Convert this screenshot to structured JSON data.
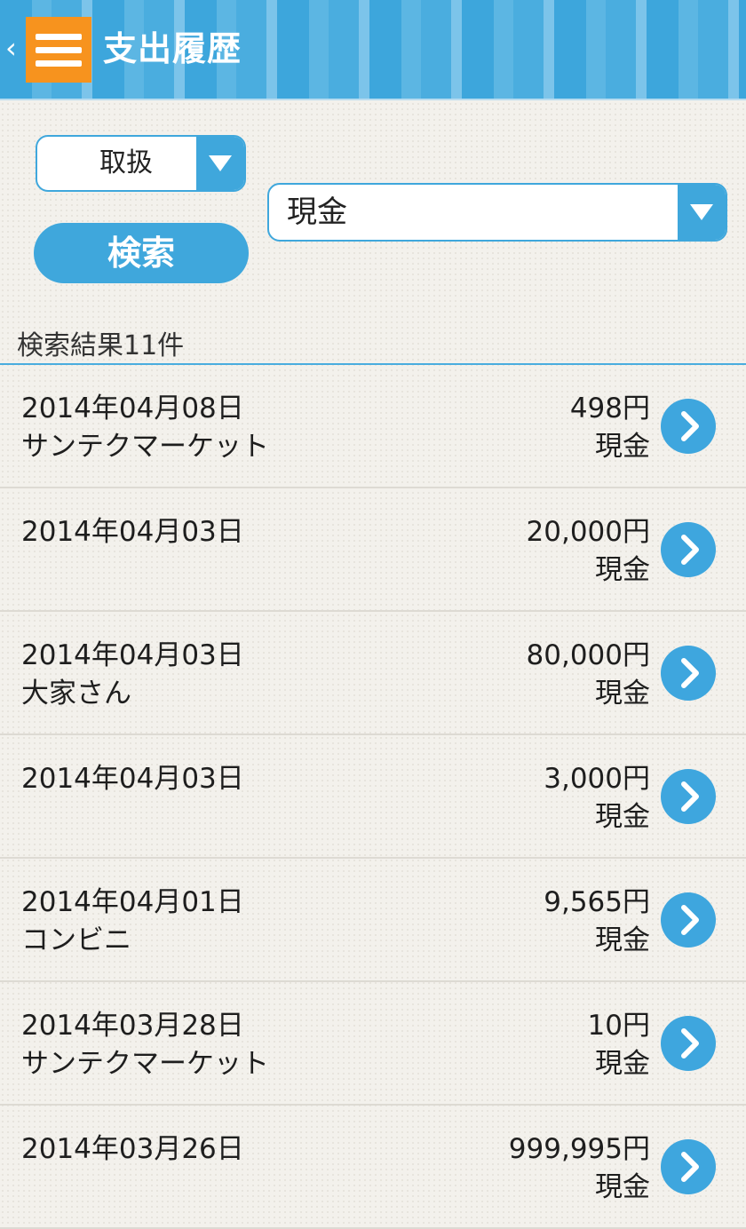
{
  "header": {
    "back_glyph": "‹",
    "title": "支出履歴"
  },
  "filters": {
    "type_select": "取扱",
    "payment_select": "現金",
    "search_button": "検索"
  },
  "results": {
    "count_label": "検索結果11件",
    "items": [
      {
        "date": "2014年04月08日",
        "shop": "サンテクマーケット",
        "amount": "498円",
        "method": "現金"
      },
      {
        "date": "2014年04月03日",
        "shop": "",
        "amount": "20,000円",
        "method": "現金"
      },
      {
        "date": "2014年04月03日",
        "shop": "大家さん",
        "amount": "80,000円",
        "method": "現金"
      },
      {
        "date": "2014年04月03日",
        "shop": "",
        "amount": "3,000円",
        "method": "現金"
      },
      {
        "date": "2014年04月01日",
        "shop": "コンビニ",
        "amount": "9,565円",
        "method": "現金"
      },
      {
        "date": "2014年03月28日",
        "shop": "サンテクマーケット",
        "amount": "10円",
        "method": "現金"
      },
      {
        "date": "2014年03月26日",
        "shop": "",
        "amount": "999,995円",
        "method": "現金"
      }
    ]
  },
  "colors": {
    "accent_blue": "#3fa7dc",
    "menu_orange": "#f7931e"
  },
  "icons": {
    "menu": "hamburger-menu-icon",
    "back": "chevron-left-icon",
    "dropdown": "triangle-down-icon",
    "row_action": "chevron-right-circle-icon"
  }
}
